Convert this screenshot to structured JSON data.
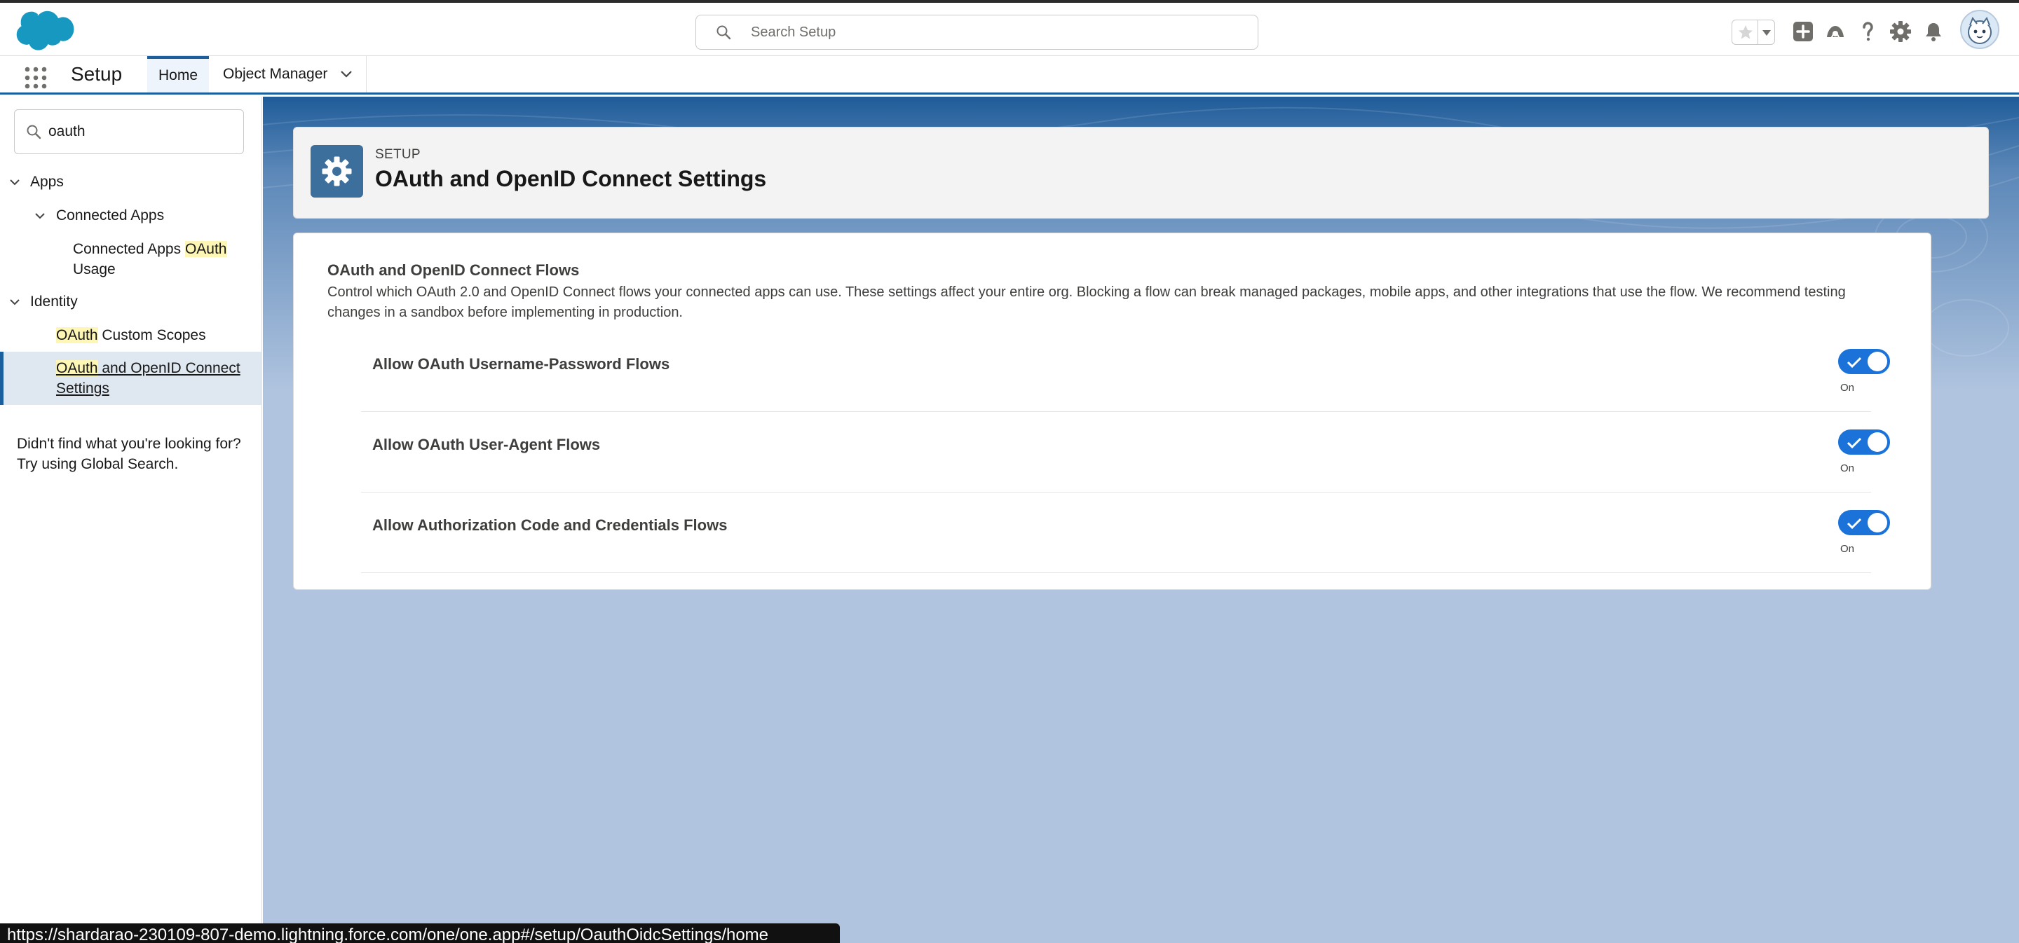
{
  "header": {
    "search_placeholder": "Search Setup"
  },
  "app_nav": {
    "app_name": "Setup",
    "tabs": [
      {
        "label": "Home"
      },
      {
        "label": "Object Manager"
      }
    ]
  },
  "sidebar": {
    "quick_find_value": "oauth",
    "tree": {
      "apps": "Apps",
      "connected_apps": "Connected Apps",
      "connected_apps_oauth_usage_a": "Connected Apps ",
      "connected_apps_oauth_usage_hl": "OAuth",
      "connected_apps_oauth_usage_b": "Usage",
      "identity": "Identity",
      "custom_scopes_hl": "OAuth",
      "custom_scopes_rest": " Custom Scopes",
      "openid_hl": "OAuth",
      "openid_rest1": " and OpenID Connect",
      "openid_rest2": "Settings"
    },
    "help_line1": "Didn't find what you're looking for?",
    "help_line2": "Try using Global Search."
  },
  "page_header": {
    "eyebrow": "SETUP",
    "title": "OAuth and OpenID Connect Settings"
  },
  "card": {
    "title": "OAuth and OpenID Connect Flows",
    "description": "Control which OAuth 2.0 and OpenID Connect flows your connected apps can use. These settings affect your entire org. Blocking a flow can break managed packages, mobile apps, and other integrations that use the flow. We recommend testing changes in a sandbox before implementing in production.",
    "settings": [
      {
        "label": "Allow OAuth Username-Password Flows",
        "state": "On"
      },
      {
        "label": "Allow OAuth User-Agent Flows",
        "state": "On"
      },
      {
        "label": "Allow Authorization Code and Credentials Flows",
        "state": "On"
      }
    ]
  },
  "status_bar": {
    "url": "https://shardarao-230109-807-demo.lightning.force.com/one/one.app#/setup/OauthOidcSettings/home"
  },
  "colors": {
    "brand_blue": "#1b73d9",
    "nav_accent": "#1b5f9e",
    "content_bg": "#b0c4df",
    "highlight": "#fdf6b4"
  },
  "icons": [
    "salesforce-cloud-logo",
    "search-icon",
    "star-icon",
    "add-icon",
    "trailhead-icon",
    "help-icon",
    "gear-icon",
    "bell-icon",
    "avatar",
    "app-launcher-icon",
    "chevron-down-icon",
    "check-icon"
  ]
}
